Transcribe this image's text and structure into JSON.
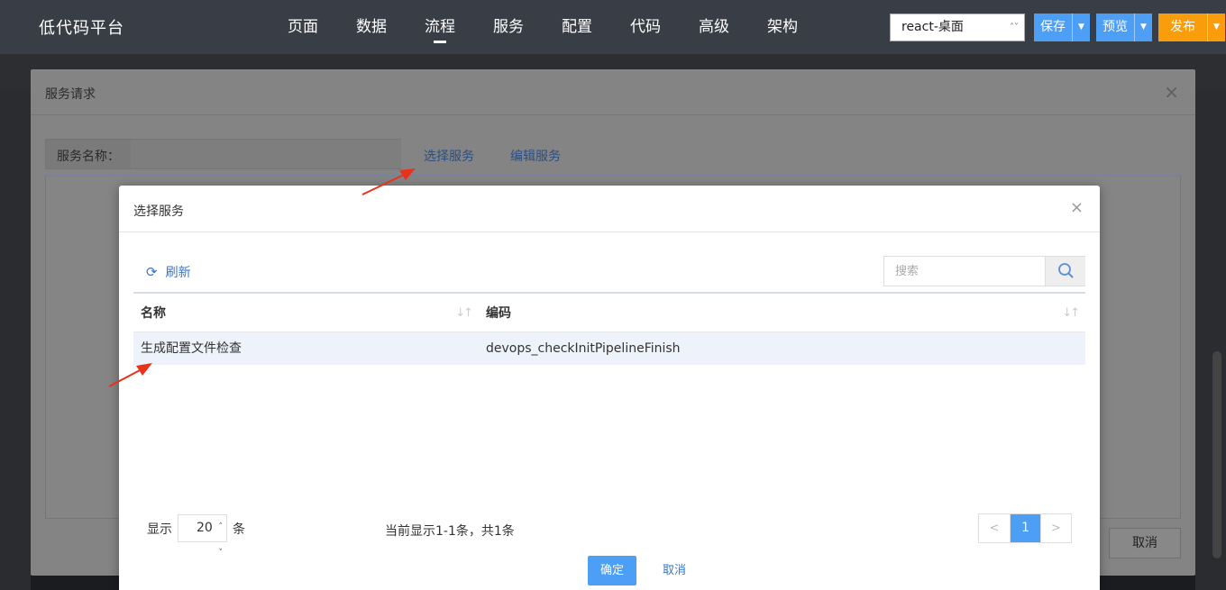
{
  "app": {
    "title": "低代码平台",
    "nav": [
      "页面",
      "数据",
      "流程",
      "服务",
      "配置",
      "代码",
      "高级",
      "架构"
    ],
    "active_nav": "流程",
    "env_select": "react-桌面",
    "buttons": {
      "save": "保存",
      "preview": "预览",
      "publish": "发布"
    },
    "colors": {
      "topbar": "#393d45",
      "primary": "#4d9ff5",
      "publish": "#f99d0b"
    }
  },
  "outer_dialog": {
    "title": "服务请求",
    "service_name_label": "服务名称：",
    "service_name_value": "",
    "select_service_link": "选择服务",
    "edit_service_link": "编辑服务",
    "cancel_button": "取消"
  },
  "inner_dialog": {
    "title": "选择服务",
    "refresh_label": "刷新",
    "search_placeholder": "搜索",
    "table": {
      "columns": [
        "名称",
        "编码"
      ],
      "rows": [
        {
          "name": "生成配置文件检查",
          "code": "devops_checkInitPipelineFinish",
          "selected": true
        }
      ]
    },
    "pager": {
      "show_label": "显示",
      "page_size": "20",
      "unit_label": "条",
      "info": "当前显示1-1条，共1条",
      "prev": "<",
      "current_page": "1",
      "next": ">"
    },
    "confirm_button": "确定",
    "cancel_button": "取消"
  },
  "icons": {
    "refresh": "refresh-icon",
    "search": "search-icon",
    "close": "close-icon",
    "sort": "sort-icon",
    "dropdown": "chevron-down-icon"
  },
  "annotations": {
    "arrow_color": "#e8321c"
  }
}
